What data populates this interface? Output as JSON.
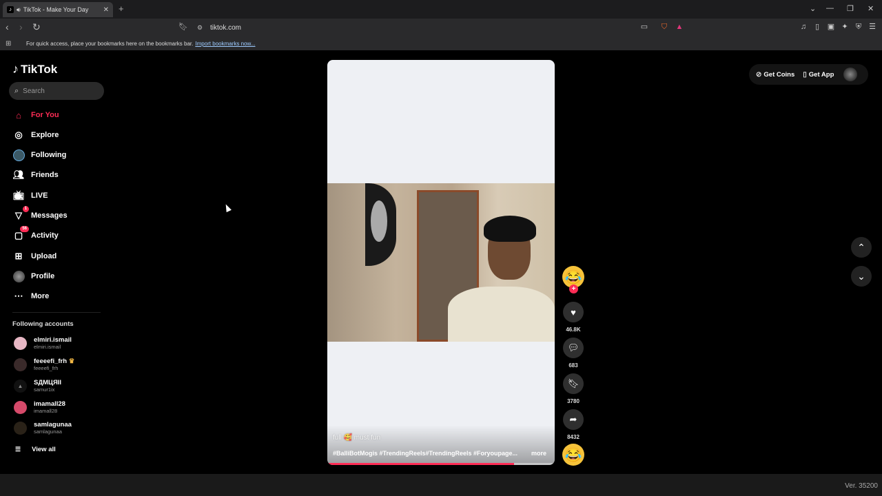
{
  "browser": {
    "tab_title": "TikTok - Make Your Day",
    "url": "tiktok.com",
    "bookmark_hint": "For quick access, place your bookmarks here on the bookmarks bar.",
    "bookmark_import": "Import bookmarks now..."
  },
  "app": {
    "logo": "TikTok",
    "search_placeholder": "Search",
    "nav": [
      {
        "label": "For You",
        "icon": "home-icon",
        "active": true
      },
      {
        "label": "Explore",
        "icon": "compass-icon"
      },
      {
        "label": "Following",
        "icon": "following-avatar-icon"
      },
      {
        "label": "Friends",
        "icon": "friends-icon"
      },
      {
        "label": "LIVE",
        "icon": "live-tv-icon"
      },
      {
        "label": "Messages",
        "icon": "messages-icon",
        "badge": "1"
      },
      {
        "label": "Activity",
        "icon": "activity-icon",
        "badge": "56"
      },
      {
        "label": "Upload",
        "icon": "upload-icon"
      },
      {
        "label": "Profile",
        "icon": "profile-avatar-icon"
      },
      {
        "label": "More",
        "icon": "more-dots-icon"
      }
    ],
    "following_title": "Following accounts",
    "accounts": [
      {
        "name": "elmiri.ismail",
        "handle": "elmiri.ismail"
      },
      {
        "name": "feeeefi_frh",
        "handle": "feeeefi_frh"
      },
      {
        "name": "SДMЦЯII",
        "handle": "samur1ix"
      },
      {
        "name": "imamall28",
        "handle": "imamall28"
      },
      {
        "name": "samlagunaa",
        "handle": "samlagunaa"
      }
    ],
    "view_all": "View all",
    "top_right": {
      "coins": "Get Coins",
      "app": "Get App"
    }
  },
  "video": {
    "caption": "full 🥰 must fun",
    "hashtags": "#BalliBotMogis #TrendingReels#TrendingReels #Foryoupage...",
    "more": "more",
    "progress": 0.82,
    "likes": "46.8K",
    "comments": "683",
    "saves": "3780",
    "shares": "8432"
  },
  "colors": {
    "accent": "#fe2c55",
    "bg": "#000000"
  },
  "footer": {
    "version": "Ver. 35200"
  }
}
